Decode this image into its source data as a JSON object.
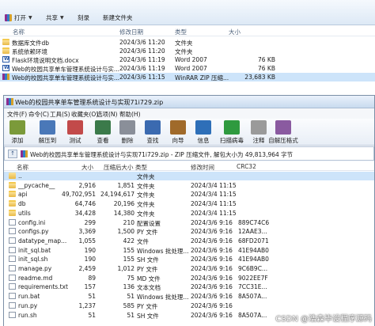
{
  "explorer": {
    "toolbar": {
      "open": "打开",
      "share": "共享",
      "burn": "刻录",
      "new_folder": "新建文件夹"
    },
    "columns": {
      "name": "名称",
      "modified": "修改日期",
      "type": "类型",
      "size": "大小"
    },
    "rows": [
      {
        "name": "数据库文件db",
        "modified": "2024/3/6 11:20",
        "type": "文件夹",
        "size": "",
        "icon": "folder-icon"
      },
      {
        "name": "系统依赖环境",
        "modified": "2024/3/6 11:20",
        "type": "文件夹",
        "size": "",
        "icon": "folder-icon"
      },
      {
        "name": "Flask环境说明文档.docx",
        "modified": "2024/3/6 11:19",
        "type": "Word 2007",
        "size": "76 KB",
        "icon": "word-doc-icon"
      },
      {
        "name": "Web的校园共享单车管理系统设计与实...",
        "modified": "2024/3/6 11:19",
        "type": "Word 2007",
        "size": "76 KB",
        "icon": "word-doc-icon"
      },
      {
        "name": "Web的校园共享单车管理系统设计与实...",
        "modified": "2024/3/6 11:15",
        "type": "WinRAR ZIP 压缩...",
        "size": "23,683 KB",
        "icon": "rar-archive-icon",
        "selected": true
      }
    ]
  },
  "winrar": {
    "title": "Web的校园共享单车管理系统设计与实现71i729.zip",
    "menu": [
      "文件(F)",
      "命令(C)",
      "工具(S)",
      "收藏夹(O)",
      "选项(N)",
      "帮助(H)"
    ],
    "tools": [
      {
        "label": "添加",
        "icon": "add-icon",
        "color": "#7b9a3a"
      },
      {
        "label": "解压到",
        "icon": "extract-icon",
        "color": "#4a78b8"
      },
      {
        "label": "测试",
        "icon": "test-icon",
        "color": "#c24a4a"
      },
      {
        "label": "查看",
        "icon": "view-icon",
        "color": "#3b7a4a"
      },
      {
        "label": "删除",
        "icon": "delete-icon",
        "color": "#8a8f99"
      },
      {
        "label": "查找",
        "icon": "find-icon",
        "color": "#3b6ab0"
      },
      {
        "label": "向导",
        "icon": "wizard-icon",
        "color": "#a06a2a"
      },
      {
        "label": "信息",
        "icon": "info-icon",
        "color": "#2e6fb8"
      },
      {
        "label": "扫描病毒",
        "icon": "virus-scan-icon",
        "color": "#2f9a3f"
      },
      {
        "label": "注释",
        "icon": "comment-icon",
        "color": "#9a9a9a"
      },
      {
        "label": "自解压格式",
        "icon": "sfx-icon",
        "color": "#8a5aa0"
      }
    ],
    "path": "Web的校园共享单车管理系统设计与实现71i729.zip - ZIP 压缩文件, 解包大小为 49,813,964 字节",
    "columns": {
      "name": "名称",
      "size": "大小",
      "packed": "压缩后大小",
      "type": "类型",
      "modified": "修改时间",
      "crc": "CRC32"
    },
    "rows": [
      {
        "name": "..",
        "size": "",
        "packed": "",
        "type": "文件夹",
        "modified": "",
        "crc": "",
        "icon": "parent-folder-icon",
        "selected": true
      },
      {
        "name": "__pycache__",
        "size": "2,916",
        "packed": "1,851",
        "type": "文件夹",
        "modified": "2024/3/4 11:15",
        "crc": "",
        "icon": "folder-icon"
      },
      {
        "name": "api",
        "size": "49,702,951",
        "packed": "24,194,617",
        "type": "文件夹",
        "modified": "2024/3/4 11:15",
        "crc": "",
        "icon": "folder-icon"
      },
      {
        "name": "db",
        "size": "64,746",
        "packed": "20,196",
        "type": "文件夹",
        "modified": "2024/3/4 11:15",
        "crc": "",
        "icon": "folder-icon"
      },
      {
        "name": "utils",
        "size": "34,428",
        "packed": "14,380",
        "type": "文件夹",
        "modified": "2024/3/4 11:15",
        "crc": "",
        "icon": "folder-icon"
      },
      {
        "name": "config.ini",
        "size": "299",
        "packed": "210",
        "type": "配置设置",
        "modified": "2024/3/6 9:16",
        "crc": "889C74C6",
        "icon": "file-icon"
      },
      {
        "name": "configs.py",
        "size": "3,369",
        "packed": "1,500",
        "type": "PY 文件",
        "modified": "2024/3/6 9:16",
        "crc": "12AAE3...",
        "icon": "file-icon"
      },
      {
        "name": "datatype_map...",
        "size": "1,055",
        "packed": "422",
        "type": "文件",
        "modified": "2024/3/6 9:16",
        "crc": "68FD2071",
        "icon": "file-icon"
      },
      {
        "name": "init_sql.bat",
        "size": "190",
        "packed": "155",
        "type": "Windows 批处理...",
        "modified": "2024/3/6 9:16",
        "crc": "41E94AB0",
        "icon": "file-icon"
      },
      {
        "name": "init_sql.sh",
        "size": "190",
        "packed": "155",
        "type": "SH 文件",
        "modified": "2024/3/6 9:16",
        "crc": "41E94AB0",
        "icon": "file-icon"
      },
      {
        "name": "manage.py",
        "size": "2,459",
        "packed": "1,012",
        "type": "PY 文件",
        "modified": "2024/3/6 9:16",
        "crc": "9C6B9C...",
        "icon": "file-icon"
      },
      {
        "name": "readme.md",
        "size": "89",
        "packed": "75",
        "type": "MD 文件",
        "modified": "2024/3/6 9:16",
        "crc": "9022EE7F",
        "icon": "file-icon"
      },
      {
        "name": "requirements.txt",
        "size": "157",
        "packed": "136",
        "type": "文本文档",
        "modified": "2024/3/6 9:16",
        "crc": "7CC31E...",
        "icon": "file-icon"
      },
      {
        "name": "run.bat",
        "size": "51",
        "packed": "51",
        "type": "Windows 批处理...",
        "modified": "2024/3/6 9:16",
        "crc": "8A507A...",
        "icon": "file-icon"
      },
      {
        "name": "run.py",
        "size": "1,237",
        "packed": "585",
        "type": "PY 文件",
        "modified": "2024/3/6 9:16",
        "crc": "",
        "icon": "file-icon"
      },
      {
        "name": "run.sh",
        "size": "51",
        "packed": "51",
        "type": "SH 文件",
        "modified": "2024/3/6 9:16",
        "crc": "8A507A...",
        "icon": "file-icon"
      }
    ]
  },
  "watermark": "CSDN @浩森毕设程序源码"
}
